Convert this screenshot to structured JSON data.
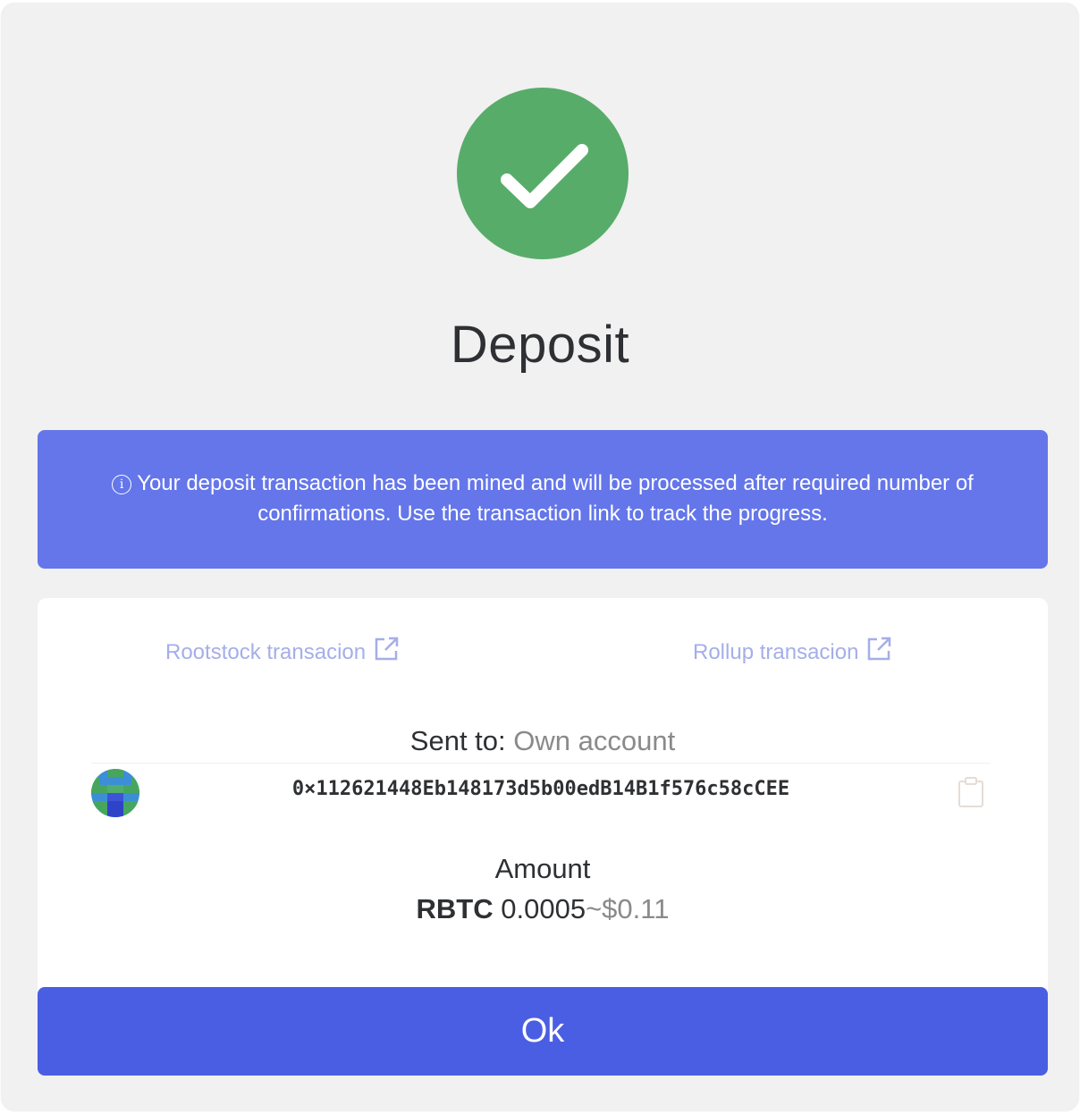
{
  "dialog": {
    "title": "Deposit",
    "status_icon": "check-circle-icon",
    "colors": {
      "success": "#58ac6a",
      "info_banner": "#6476ea",
      "primary_button": "#4a5ee3",
      "link": "#a5aee8"
    }
  },
  "info": {
    "icon": "ⓘ",
    "message": "Your deposit transaction has been mined and will be processed after required number of confirmations. Use the transaction link to track the progress."
  },
  "links": {
    "rootstock_label": "Rootstock transacion",
    "rollup_label": "Rollup transacion",
    "icon": "external-link-icon"
  },
  "recipient": {
    "label": "Sent to:",
    "value": "Own account",
    "address": "0×112621448Eb148173d5b00edB14B1f576c58cCEE",
    "avatar": "identicon-avatar",
    "copy_icon": "clipboard-icon"
  },
  "amount": {
    "label": "Amount",
    "symbol": "RBTC",
    "value": "0.0005",
    "fiat": "~$0.11"
  },
  "actions": {
    "ok_label": "Ok"
  }
}
